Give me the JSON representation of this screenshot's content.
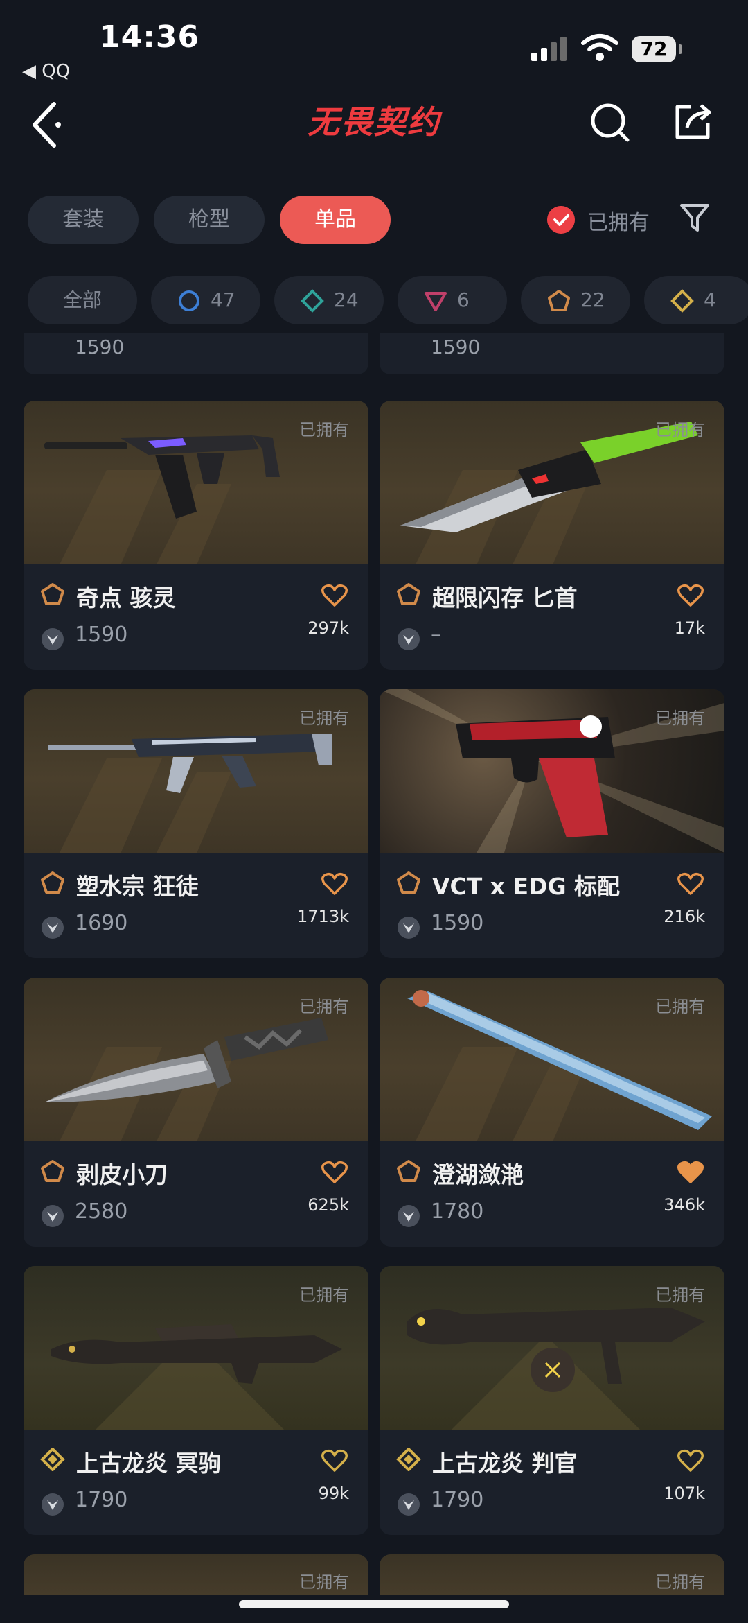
{
  "status_bar": {
    "time": "14:36",
    "back_app": "◀ QQ",
    "battery": "72"
  },
  "header": {
    "logo_text": "无畏契约"
  },
  "tabs": [
    {
      "label": "套装",
      "active": false
    },
    {
      "label": "枪型",
      "active": false
    },
    {
      "label": "单品",
      "active": true
    }
  ],
  "owned_filter": {
    "label": "已拥有",
    "checked": true
  },
  "rarity_chips": [
    {
      "label": "全部"
    },
    {
      "count": "47",
      "color": "#3d7fd6",
      "icon": "circle-tier-icon"
    },
    {
      "count": "24",
      "color": "#2fa39a",
      "icon": "diamond-tier-icon"
    },
    {
      "count": "6",
      "color": "#c0406a",
      "icon": "triangle-tier-icon"
    },
    {
      "count": "22",
      "color": "#d18a4a",
      "icon": "pentagon-tier-icon"
    },
    {
      "count": "4",
      "color": "#d4b04a",
      "icon": "diamond-gold-tier-icon"
    }
  ],
  "partial_row": {
    "left_price": "1590",
    "right_price": "1590"
  },
  "items": [
    {
      "name": "奇点 骇灵",
      "price": "1590",
      "likes": "297k",
      "owned": "已拥有",
      "favorited": false,
      "tier": "pentagon"
    },
    {
      "name": "超限闪存 匕首",
      "price": "–",
      "likes": "17k",
      "owned": "已拥有",
      "favorited": false,
      "tier": "pentagon"
    },
    {
      "name": "塑水宗 狂徒",
      "price": "1690",
      "likes": "1713k",
      "owned": "已拥有",
      "favorited": false,
      "tier": "pentagon"
    },
    {
      "name": "VCT x EDG 标配",
      "price": "1590",
      "likes": "216k",
      "owned": "已拥有",
      "favorited": false,
      "tier": "pentagon"
    },
    {
      "name": "剥皮小刀",
      "price": "2580",
      "likes": "625k",
      "owned": "已拥有",
      "favorited": false,
      "tier": "pentagon"
    },
    {
      "name": "澄湖潋滟",
      "price": "1780",
      "likes": "346k",
      "owned": "已拥有",
      "favorited": true,
      "tier": "pentagon"
    },
    {
      "name": "上古龙炎 冥驹",
      "price": "1790",
      "likes": "99k",
      "owned": "已拥有",
      "favorited": false,
      "tier": "diamond"
    },
    {
      "name": "上古龙炎 判官",
      "price": "1790",
      "likes": "107k",
      "owned": "已拥有",
      "favorited": false,
      "tier": "diamond"
    }
  ],
  "bottom_partial": {
    "left_owned": "已拥有",
    "right_owned": "已拥有"
  },
  "colors": {
    "accent": "#ec5a55",
    "pentagon_tier": "#d18a4a",
    "diamond_tier": "#d4b04a",
    "heart": "#e8944a"
  }
}
